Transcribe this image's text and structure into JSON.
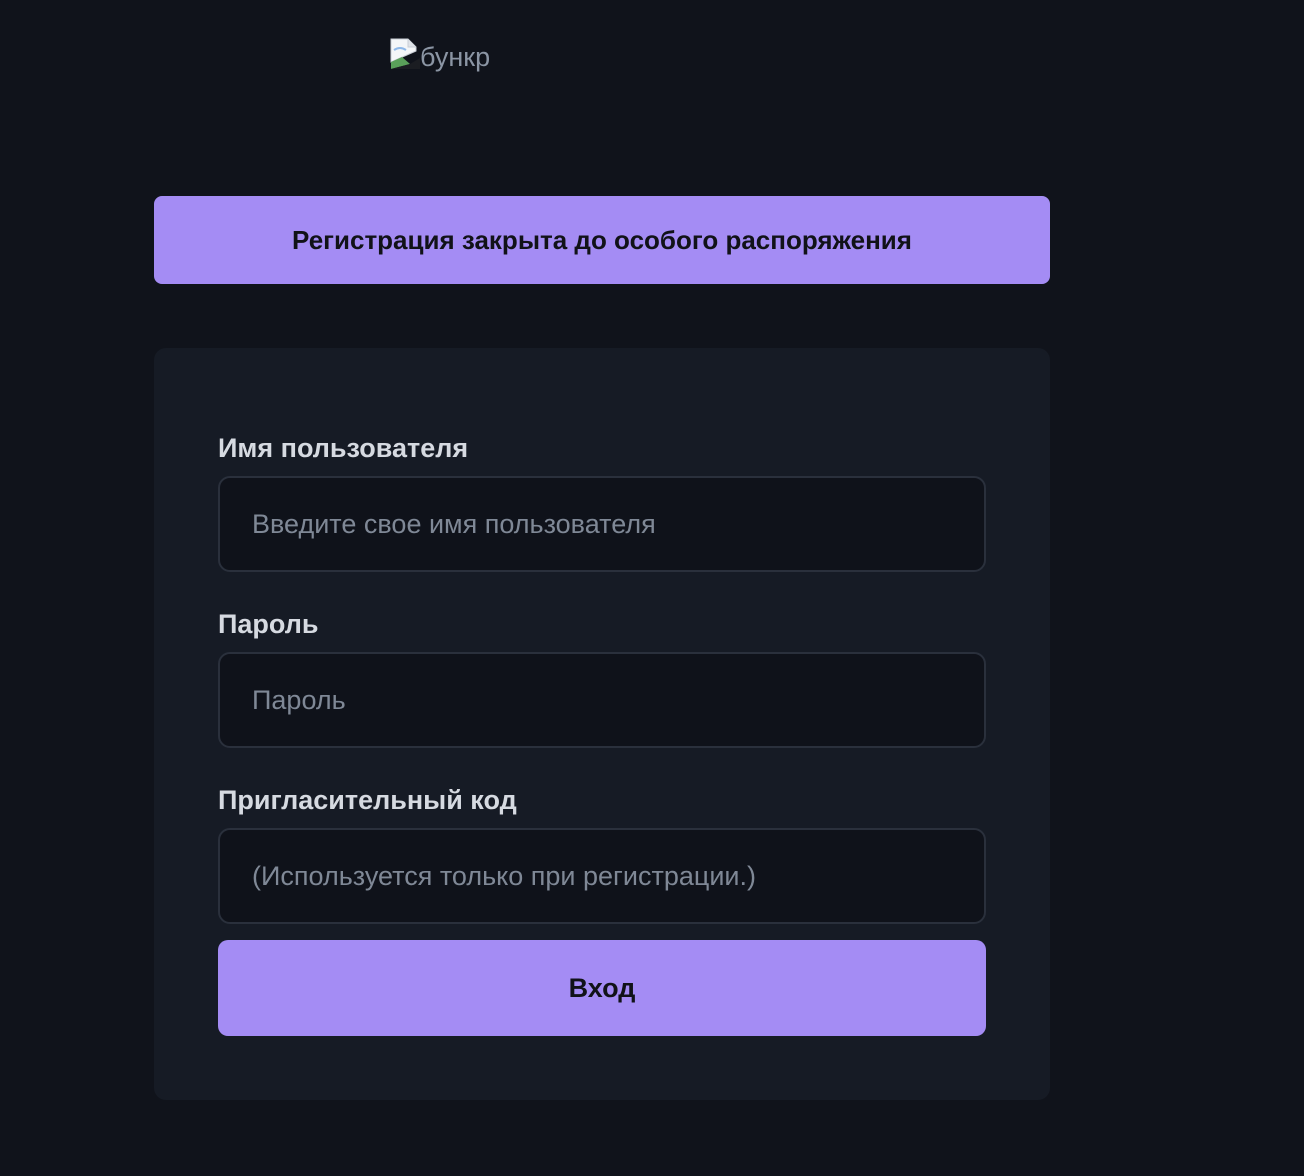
{
  "logo": {
    "alt_text": "бункр",
    "icon": "broken-image-icon"
  },
  "banner": {
    "text": "Регистрация закрыта до особого распоряжения"
  },
  "form": {
    "username": {
      "label": "Имя пользователя",
      "placeholder": "Введите свое имя пользователя",
      "value": ""
    },
    "password": {
      "label": "Пароль",
      "placeholder": "Пароль",
      "value": ""
    },
    "invite_code": {
      "label": "Пригласительный код",
      "placeholder": "(Используется только при регистрации.)",
      "value": ""
    },
    "submit_label": "Вход"
  },
  "colors": {
    "background": "#10131b",
    "card": "#161b25",
    "accent": "#a48cf4",
    "input_bg": "#0f121a",
    "input_border": "#2a303c"
  }
}
